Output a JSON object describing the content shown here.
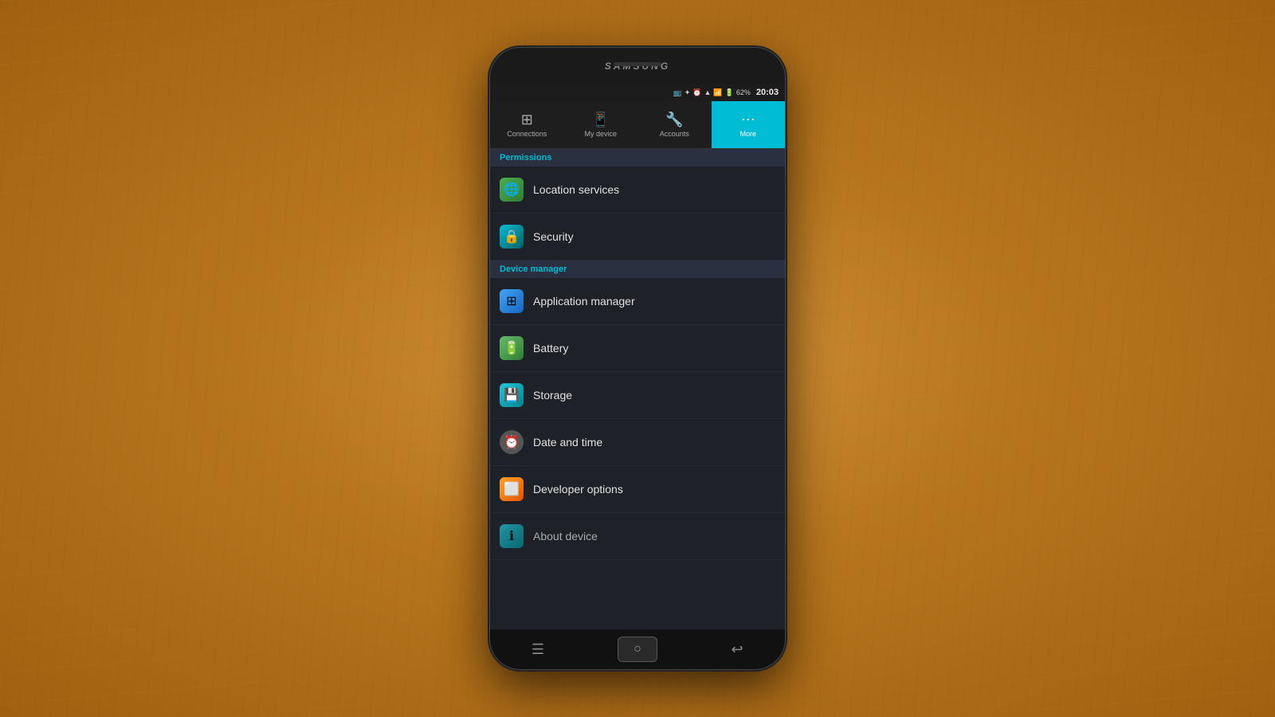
{
  "phone": {
    "brand": "SAMSUNG",
    "status_bar": {
      "time": "20:03",
      "battery_percent": "62%",
      "icons": [
        "📶",
        "🔋"
      ]
    },
    "tabs": [
      {
        "id": "connections",
        "label": "Connections",
        "icon": "⊞",
        "active": false
      },
      {
        "id": "my_device",
        "label": "My device",
        "icon": "📱",
        "active": false
      },
      {
        "id": "accounts",
        "label": "Accounts",
        "icon": "🔧",
        "active": false
      },
      {
        "id": "more",
        "label": "More",
        "icon": "⋯",
        "active": true
      }
    ],
    "sections": [
      {
        "id": "permissions",
        "header": "Permissions",
        "items": [
          {
            "id": "location_services",
            "label": "Location services",
            "icon": "🌐",
            "icon_class": "green"
          },
          {
            "id": "security",
            "label": "Security",
            "icon": "🔒",
            "icon_class": "teal"
          }
        ]
      },
      {
        "id": "device_manager",
        "header": "Device manager",
        "items": [
          {
            "id": "application_manager",
            "label": "Application manager",
            "icon": "⊞",
            "icon_class": "blue-grid"
          },
          {
            "id": "battery",
            "label": "Battery",
            "icon": "🔋",
            "icon_class": "battery-green"
          },
          {
            "id": "storage",
            "label": "Storage",
            "icon": "💾",
            "icon_class": "storage-teal"
          },
          {
            "id": "date_and_time",
            "label": "Date and time",
            "icon": "⏰",
            "icon_class": "gray-circle"
          },
          {
            "id": "developer_options",
            "label": "Developer options",
            "icon": "⬜",
            "icon_class": "dev-orange"
          },
          {
            "id": "about_device",
            "label": "About device",
            "icon": "ℹ",
            "icon_class": "about-teal",
            "partial": true
          }
        ]
      }
    ],
    "bottom_nav": {
      "menu_icon": "☰",
      "home_icon": "○",
      "back_icon": "↩"
    }
  }
}
